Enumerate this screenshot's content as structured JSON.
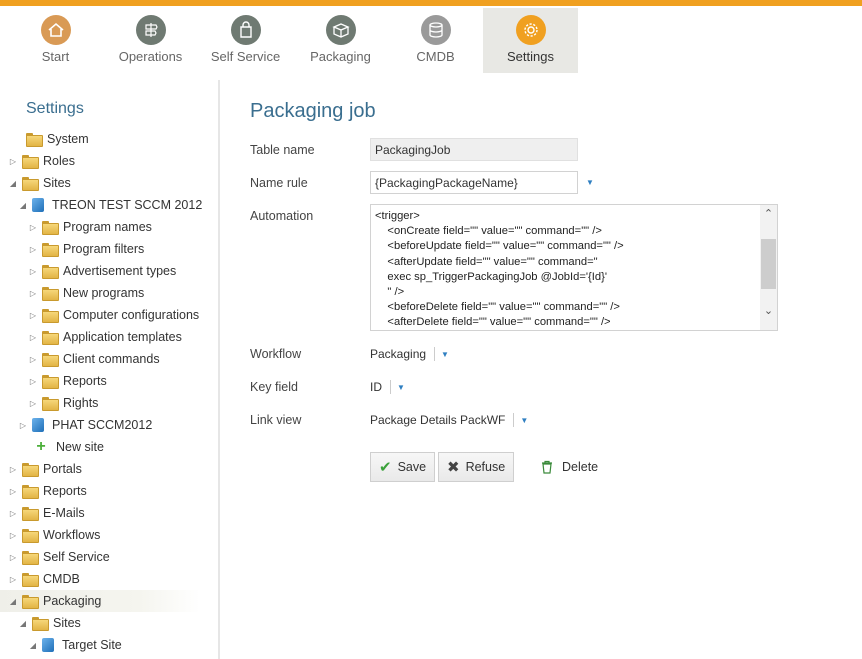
{
  "nav": {
    "items": [
      {
        "label": "Start",
        "icon": "house-icon",
        "color": "#d99a55"
      },
      {
        "label": "Operations",
        "icon": "signpost-icon",
        "color": "#6f7a72"
      },
      {
        "label": "Self Service",
        "icon": "shopping-bag-icon",
        "color": "#6f7a72"
      },
      {
        "label": "Packaging",
        "icon": "box-icon",
        "color": "#6f7a72"
      },
      {
        "label": "CMDB",
        "icon": "database-icon",
        "color": "#9a9a9a"
      },
      {
        "label": "Settings",
        "icon": "gear-icon",
        "color": "#f0a020"
      }
    ],
    "active": "Settings"
  },
  "sidebar": {
    "title": "Settings",
    "tree": [
      {
        "label": "System",
        "type": "folder"
      },
      {
        "label": "Roles",
        "type": "folder"
      },
      {
        "label": "Sites",
        "type": "folder"
      },
      {
        "label": "TREON TEST SCCM 2012",
        "type": "site"
      },
      {
        "label": "Program names",
        "type": "folder"
      },
      {
        "label": "Program filters",
        "type": "folder"
      },
      {
        "label": "Advertisement types",
        "type": "folder"
      },
      {
        "label": "New programs",
        "type": "folder"
      },
      {
        "label": "Computer configurations",
        "type": "folder"
      },
      {
        "label": "Application templates",
        "type": "folder"
      },
      {
        "label": "Client commands",
        "type": "folder"
      },
      {
        "label": "Reports",
        "type": "folder"
      },
      {
        "label": "Rights",
        "type": "folder"
      },
      {
        "label": "PHAT SCCM2012",
        "type": "site"
      },
      {
        "label": "New site",
        "type": "add"
      },
      {
        "label": "Portals",
        "type": "folder"
      },
      {
        "label": "Reports",
        "type": "folder"
      },
      {
        "label": "E-Mails",
        "type": "folder"
      },
      {
        "label": "Workflows",
        "type": "folder"
      },
      {
        "label": "Self Service",
        "type": "folder"
      },
      {
        "label": "CMDB",
        "type": "folder"
      },
      {
        "label": "Packaging",
        "type": "folder"
      },
      {
        "label": "Sites",
        "type": "folder"
      },
      {
        "label": "Target Site",
        "type": "site"
      }
    ],
    "selected": "Packaging"
  },
  "main": {
    "title": "Packaging job",
    "table_name": {
      "label": "Table name",
      "value": "PackagingJob"
    },
    "name_rule": {
      "label": "Name rule",
      "value": "{PackagingPackageName}"
    },
    "automation": {
      "label": "Automation",
      "value": "<trigger>\n    <onCreate field=\"\" value=\"\" command=\"\" />\n    <beforeUpdate field=\"\" value=\"\" command=\"\" />\n    <afterUpdate field=\"\" value=\"\" command=\"\n    exec sp_TriggerPackagingJob @JobId='{Id}'\n    \" />\n    <beforeDelete field=\"\" value=\"\" command=\"\" />\n    <afterDelete field=\"\" value=\"\" command=\"\" />"
    },
    "workflow": {
      "label": "Workflow",
      "value": "Packaging"
    },
    "key_field": {
      "label": "Key field",
      "value": "ID"
    },
    "link_view": {
      "label": "Link view",
      "value": "Package Details PackWF"
    },
    "buttons": {
      "save": "Save",
      "refuse": "Refuse",
      "delete": "Delete"
    }
  },
  "colors": {
    "accent": "#f0a020",
    "title": "#3a6e8f",
    "link": "#2f7fc1"
  }
}
